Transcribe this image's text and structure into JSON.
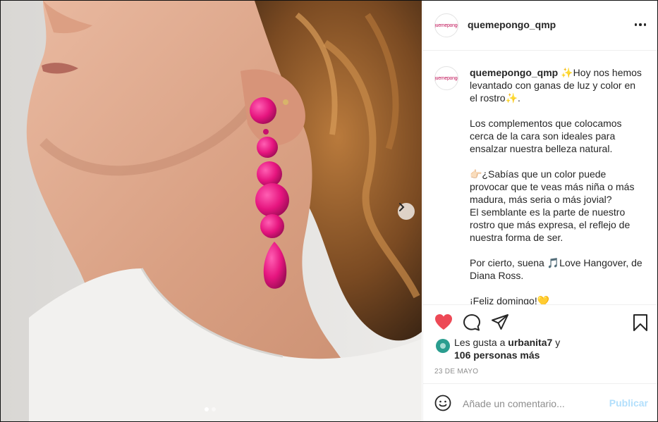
{
  "post": {
    "username": "quemepongo_qmp",
    "avatar_text": "quemepongo",
    "caption": {
      "username": "quemepongo_qmp",
      "lines": [
        "✨Hoy nos hemos levantado con ganas de luz y color en el rostro✨.",
        "Los complementos que colocamos cerca de la cara son ideales para ensalzar nuestra belleza natural.",
        "👉🏻¿Sabías que un color puede provocar que te veas más niña o más madura, más seria o más jovial?",
        "El semblante es la parte de nuestro rostro que más expresa, el reflejo de nuestra forma de ser.",
        "Por cierto, suena 🎵Love Hangover, de Diana Ross.",
        "¡Feliz domingo!💛"
      ]
    },
    "likes": {
      "prefix": "Les gusta a",
      "user": "urbanita7",
      "joiner": "y",
      "others": "106 personas más"
    },
    "date": "23 DE MAYO",
    "comment": {
      "placeholder": "Añade un comentario...",
      "publish_label": "Publicar"
    },
    "carousel": {
      "total": 2,
      "current": 1
    }
  },
  "icons": {
    "like": "heart-icon",
    "comment": "speech-bubble-icon",
    "share": "paper-plane-icon",
    "save": "bookmark-icon",
    "emoji": "smiley-icon",
    "more": "ellipsis-icon",
    "next": "chevron-right-icon"
  },
  "colors": {
    "like_active": "#ed4956",
    "publish_disabled": "#b2dffc",
    "text_primary": "#262626",
    "text_secondary": "#8e8e8e",
    "earring_pink": "#e91e8c"
  }
}
